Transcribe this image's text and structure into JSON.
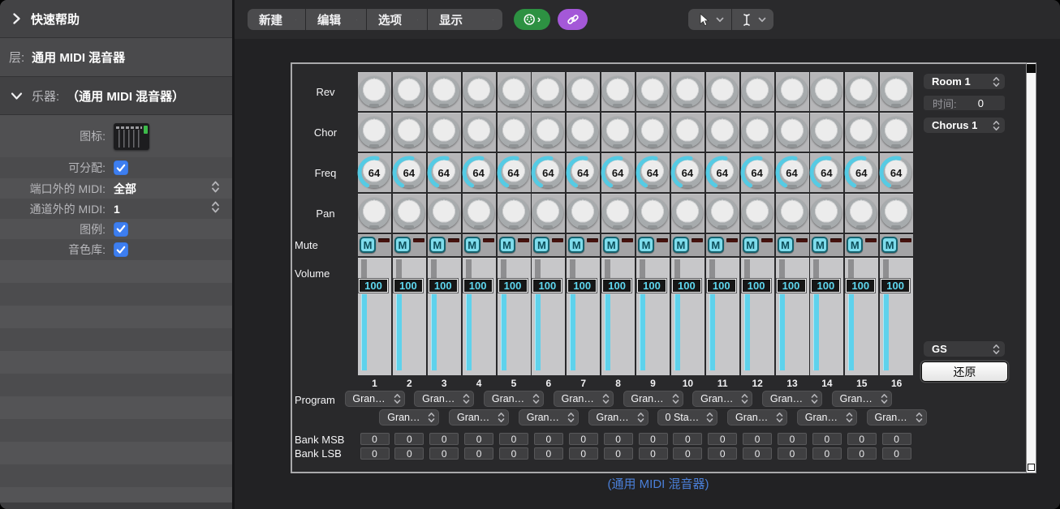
{
  "colors": {
    "accent_cyan": "#55cbe4",
    "checkbox_blue": "#3d7ef0",
    "midi_green": "#2d9142",
    "link_purple": "#a458d8",
    "caption_blue": "#4a7fd8"
  },
  "sidebar": {
    "quick_help": "快速帮助",
    "layer_label": "层:",
    "layer_value": "通用 MIDI 混音器",
    "instrument_label": "乐器:",
    "instrument_value": "（通用 MIDI 混音器）",
    "fields": [
      {
        "label": "图标:",
        "type": "icon"
      },
      {
        "label": "可分配:",
        "type": "checkbox",
        "checked": true
      },
      {
        "label": "端口外的 MIDI:",
        "type": "select",
        "value": "全部"
      },
      {
        "label": "通道外的 MIDI:",
        "type": "select",
        "value": "1"
      },
      {
        "label": "图例:",
        "type": "checkbox",
        "checked": true
      },
      {
        "label": "音色库:",
        "type": "checkbox",
        "checked": true
      }
    ]
  },
  "toolbar": {
    "menus": [
      "新建",
      "编辑",
      "选项",
      "显示"
    ]
  },
  "mixer": {
    "row_labels": [
      "Rev",
      "Chor",
      "Freq",
      "Pan",
      "Mute",
      "Volume"
    ],
    "program_label": "Program",
    "bank_msb_label": "Bank MSB",
    "bank_lsb_label": "Bank LSB",
    "mute_label": "M",
    "channels": [
      {
        "number": "1",
        "freq": "64",
        "volume": "100",
        "program": "Gran…",
        "bank_msb": "0",
        "bank_lsb": "0"
      },
      {
        "number": "2",
        "freq": "64",
        "volume": "100",
        "program": "Gran…",
        "bank_msb": "0",
        "bank_lsb": "0"
      },
      {
        "number": "3",
        "freq": "64",
        "volume": "100",
        "program": "Gran…",
        "bank_msb": "0",
        "bank_lsb": "0"
      },
      {
        "number": "4",
        "freq": "64",
        "volume": "100",
        "program": "Gran…",
        "bank_msb": "0",
        "bank_lsb": "0"
      },
      {
        "number": "5",
        "freq": "64",
        "volume": "100",
        "program": "Gran…",
        "bank_msb": "0",
        "bank_lsb": "0"
      },
      {
        "number": "6",
        "freq": "64",
        "volume": "100",
        "program": "Gran…",
        "bank_msb": "0",
        "bank_lsb": "0"
      },
      {
        "number": "7",
        "freq": "64",
        "volume": "100",
        "program": "Gran…",
        "bank_msb": "0",
        "bank_lsb": "0"
      },
      {
        "number": "8",
        "freq": "64",
        "volume": "100",
        "program": "Gran…",
        "bank_msb": "0",
        "bank_lsb": "0"
      },
      {
        "number": "9",
        "freq": "64",
        "volume": "100",
        "program": "Gran…",
        "bank_msb": "0",
        "bank_lsb": "0"
      },
      {
        "number": "10",
        "freq": "64",
        "volume": "100",
        "program": "0 Sta…",
        "bank_msb": "0",
        "bank_lsb": "0"
      },
      {
        "number": "11",
        "freq": "64",
        "volume": "100",
        "program": "Gran…",
        "bank_msb": "0",
        "bank_lsb": "0"
      },
      {
        "number": "12",
        "freq": "64",
        "volume": "100",
        "program": "Gran…",
        "bank_msb": "0",
        "bank_lsb": "0"
      },
      {
        "number": "13",
        "freq": "64",
        "volume": "100",
        "program": "Gran…",
        "bank_msb": "0",
        "bank_lsb": "0"
      },
      {
        "number": "14",
        "freq": "64",
        "volume": "100",
        "program": "Gran…",
        "bank_msb": "0",
        "bank_lsb": "0"
      },
      {
        "number": "15",
        "freq": "64",
        "volume": "100",
        "program": "Gran…",
        "bank_msb": "0",
        "bank_lsb": "0"
      },
      {
        "number": "16",
        "freq": "64",
        "volume": "100",
        "program": "Gran…",
        "bank_msb": "0",
        "bank_lsb": "0"
      }
    ],
    "right_panel": {
      "reverb_type": "Room 1",
      "time_label": "时间:",
      "time_value": "0",
      "chorus_type": "Chorus 1",
      "sound_standard": "GS",
      "reset_label": "还原"
    },
    "caption": "(通用 MIDI 混音器)"
  }
}
